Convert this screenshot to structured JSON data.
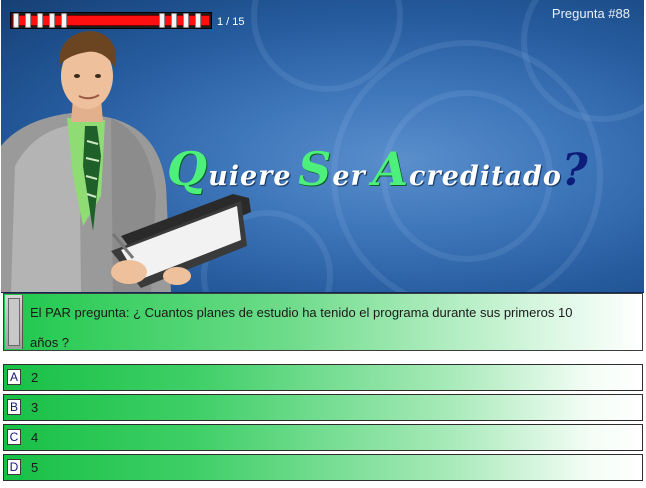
{
  "header": {
    "question_number": "Pregunta #88",
    "progress_count": "1 / 15",
    "progress": {
      "current": 1,
      "total": 15
    }
  },
  "title": {
    "part1_initial": "Q",
    "part1_rest": "uiere",
    "part2_initial": "S",
    "part2_rest": "er",
    "part3_initial": "A",
    "part3_rest": "creditado",
    "mark": "?"
  },
  "question": {
    "text": "El PAR pregunta: ¿ Cuantos planes de estudio ha tenido el programa durante sus primeros 10 años ?"
  },
  "answers": [
    {
      "letter": "A",
      "value": "2"
    },
    {
      "letter": "B",
      "value": "3"
    },
    {
      "letter": "C",
      "value": "4"
    },
    {
      "letter": "D",
      "value": "5"
    }
  ],
  "colors": {
    "accent_green": "#4cf07a",
    "progress_red": "#ff1010",
    "banner_blue": "#245a9c",
    "question_mark": "#0d1e7a"
  },
  "icons": {
    "question_handle": "scroll-handle-icon"
  }
}
